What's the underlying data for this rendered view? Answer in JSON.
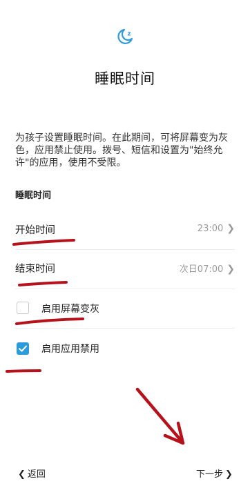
{
  "header": {
    "icon": "moon-sleep-icon",
    "title": "睡眠时间"
  },
  "description": "为孩子设置睡眠时间。在此期间，可将屏幕变为灰色，应用禁止使用。拨号、短信和设置为\"始终允许\"的应用，使用不受限。",
  "section": {
    "header": "睡眠时间"
  },
  "rows": {
    "start": {
      "label": "开始时间",
      "value": "23:00"
    },
    "end": {
      "label": "结束时间",
      "value": "次日07:00"
    }
  },
  "options": {
    "grayscale": {
      "label": "启用屏幕变灰",
      "checked": false
    },
    "app_block": {
      "label": "启用应用禁用",
      "checked": true
    }
  },
  "footer": {
    "back_label": "返回",
    "next_label": "下一步"
  },
  "colors": {
    "accent": "#2c9bdb",
    "annotation": "#b5121b"
  }
}
